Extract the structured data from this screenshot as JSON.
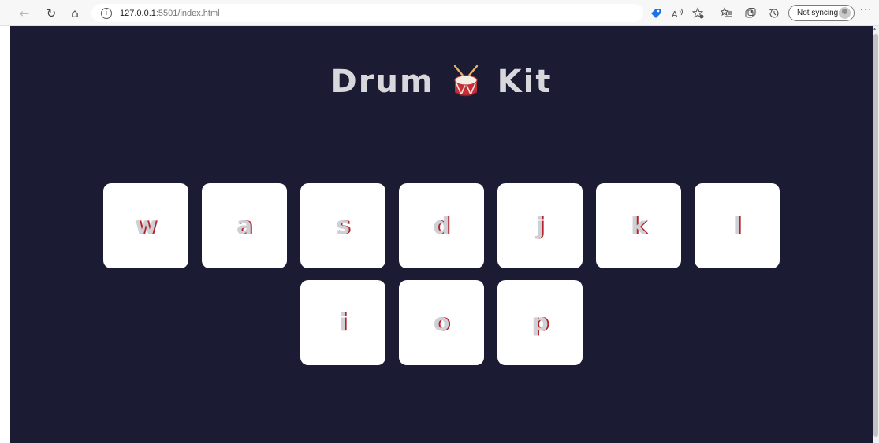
{
  "browser": {
    "back_icon": "←",
    "reload_icon": "↻",
    "home_icon": "⌂",
    "info_icon": "i",
    "url_host": "127.0.0.1",
    "url_path": ":5501/index.html",
    "sync_label": "Not syncing",
    "more_icon": "···",
    "toolbar_icons": [
      "tag-icon",
      "read-aloud-icon",
      "favorite-icon",
      "favorites-icon",
      "collections-icon",
      "history-icon"
    ]
  },
  "page": {
    "background": "#1b1b33",
    "title_left": "Drum",
    "title_right": "Kit",
    "title_color": "#d8d8dc",
    "key_shadow_color": "#b3242c"
  },
  "drums": {
    "row1": [
      "w",
      "a",
      "s",
      "d",
      "j",
      "k",
      "l"
    ],
    "row2": [
      "i",
      "o",
      "p"
    ]
  }
}
